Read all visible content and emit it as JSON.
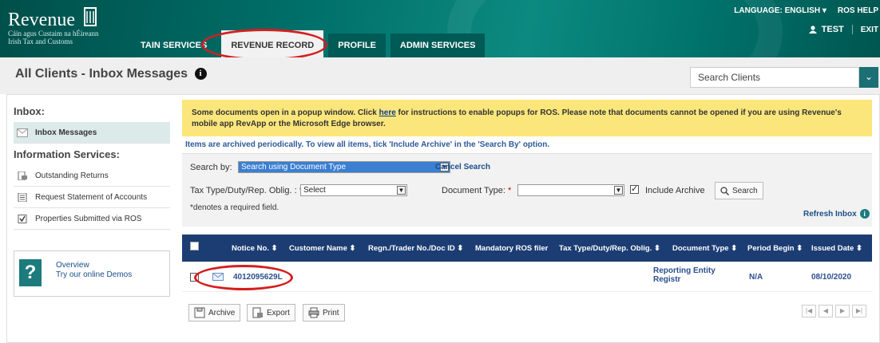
{
  "header": {
    "brand": "Revenue",
    "sub1": "Cáin agus Custaim na hÉireann",
    "sub2": "Irish Tax and Customs",
    "tabs": [
      "TAIN SERVICES",
      "REVENUE RECORD",
      "PROFILE",
      "ADMIN SERVICES"
    ],
    "language_label": "LANGUAGE: ENGLISH",
    "help": "ROS HELP",
    "user": "TEST",
    "exit": "EXIT"
  },
  "page": {
    "title": "All Clients - Inbox Messages",
    "search_clients": "Search Clients"
  },
  "sidebar": {
    "inbox_heading": "Inbox:",
    "inbox_item": "Inbox Messages",
    "info_heading": "Information Services:",
    "items": [
      {
        "label": "Outstanding Returns",
        "icon": "document-icon"
      },
      {
        "label": "Request Statement of Accounts",
        "icon": "statement-icon"
      },
      {
        "label": "Properties Submitted via ROS",
        "icon": "checkbox-icon"
      }
    ],
    "demo_line1": "Overview",
    "demo_line2": "Try our online Demos"
  },
  "notice": {
    "part1": "Some documents open in a popup window. Click ",
    "link": "here",
    "part2": " for instructions to enable popups for ROS. Please note that documents cannot be opened if you are using Revenue's mobile app RevApp or the Microsoft Edge browser."
  },
  "archived_msg": "Items are archived periodically. To view all items, tick 'Include Archive' in the 'Search By' option.",
  "filter": {
    "search_by_label": "Search by:",
    "search_by_value": "Search using Document Type",
    "cancel_search": "Cancel Search",
    "tax_type_label": "Tax Type/Duty/Rep. Oblig. :",
    "tax_type_value": "Select",
    "doc_type_label": "Document Type:",
    "doc_type_value": "",
    "include_archive": "Include Archive",
    "search_button": "Search",
    "required_note": "*denotes a required field.",
    "refresh_inbox": "Refresh Inbox"
  },
  "table": {
    "columns": [
      "Notice No. ⬍",
      "Customer Name ⬍",
      "Regn./Trader No./Doc ID ⬍",
      "Mandatory ROS filer",
      "Tax Type/Duty/Rep. Oblig. ⬍",
      "Document Type ⬍",
      "Period Begin ⬍",
      "Issued Date ⬍"
    ],
    "rows": [
      {
        "notice_no": "4012095629L",
        "document_type_1": "Reporting Entity",
        "document_type_2": "Registr",
        "period_begin": "N/A",
        "issued_date": "08/10/2020"
      }
    ]
  },
  "actions": {
    "archive": "Archive",
    "export": "Export",
    "print": "Print"
  },
  "colors": {
    "header_teal": "#00706a",
    "table_header_navy": "#1c3d73",
    "notice_yellow": "#fbe67b",
    "annotation_red": "#d41e1e"
  }
}
